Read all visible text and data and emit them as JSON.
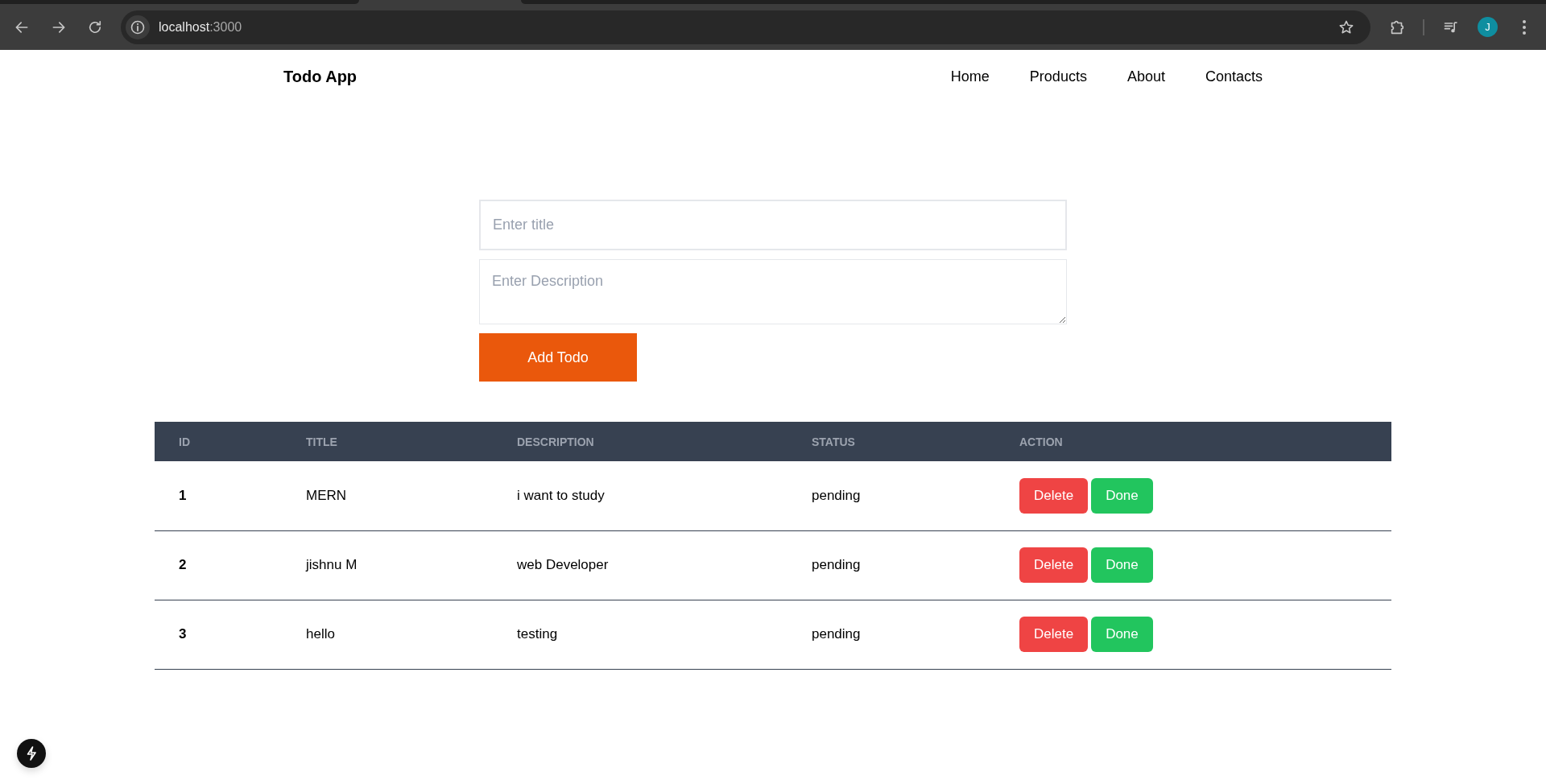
{
  "browser": {
    "url": {
      "host": "localhost",
      "port": ":3000"
    },
    "profile_initial": "J"
  },
  "navbar": {
    "brand": "Todo App",
    "links": [
      "Home",
      "Products",
      "About",
      "Contacts"
    ]
  },
  "form": {
    "title_field": {
      "placeholder": "Enter title"
    },
    "description_field": {
      "placeholder": "Enter Description"
    },
    "submit_button": "Add Todo"
  },
  "table": {
    "columns": [
      "ID",
      "TITLE",
      "DESCRIPTION",
      "STATUS",
      "ACTION"
    ],
    "rows": [
      {
        "id": "1",
        "title": "MERN",
        "description": "i want to study",
        "status": "pending",
        "actions": [
          {
            "label": "Delete",
            "kind": "delete"
          },
          {
            "label": "Done",
            "kind": "done"
          }
        ]
      },
      {
        "id": "2",
        "title": "jishnu M",
        "description": "web Developer",
        "status": "pending",
        "actions": [
          {
            "label": "Delete",
            "kind": "delete"
          },
          {
            "label": "Done",
            "kind": "done"
          }
        ]
      },
      {
        "id": "3",
        "title": "hello",
        "description": "testing",
        "status": "pending",
        "actions": [
          {
            "label": "Delete",
            "kind": "delete"
          },
          {
            "label": "Done",
            "kind": "done"
          }
        ]
      }
    ]
  }
}
